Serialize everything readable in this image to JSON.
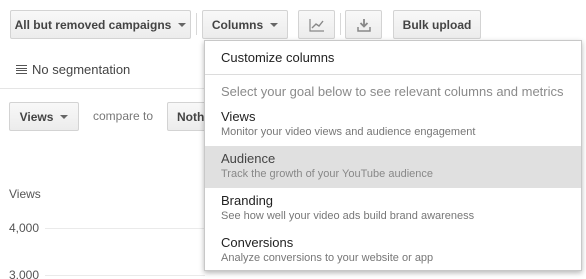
{
  "toolbar": {
    "campaign_filter_label": "All but removed campaigns",
    "columns_label": "Columns",
    "chart_toggle_icon": "line-chart-icon",
    "download_icon": "download-icon",
    "bulk_upload_label": "Bulk upload"
  },
  "segmentation": {
    "icon": "list-icon",
    "label": "No segmentation"
  },
  "metric_selector": {
    "primary_label": "Views",
    "compare_to_label": "compare to",
    "secondary_label": "Noth"
  },
  "chart": {
    "y_axis_title": "Views",
    "ticks": [
      "4,000",
      "3,000"
    ]
  },
  "columns_dropdown": {
    "customize_label": "Customize columns",
    "hint": "Select your goal below to see relevant columns and metrics",
    "items": [
      {
        "label": "Views",
        "description": "Monitor your video views and audience engagement"
      },
      {
        "label": "Audience",
        "description": "Track the growth of your YouTube audience"
      },
      {
        "label": "Branding",
        "description": "See how well your video ads build brand awareness"
      },
      {
        "label": "Conversions",
        "description": "Analyze conversions to your website or app"
      }
    ],
    "highlighted_item": "Audience"
  },
  "colors": {
    "highlight_bg": "#e0e0e0",
    "button_border": "#d3d3d3"
  }
}
